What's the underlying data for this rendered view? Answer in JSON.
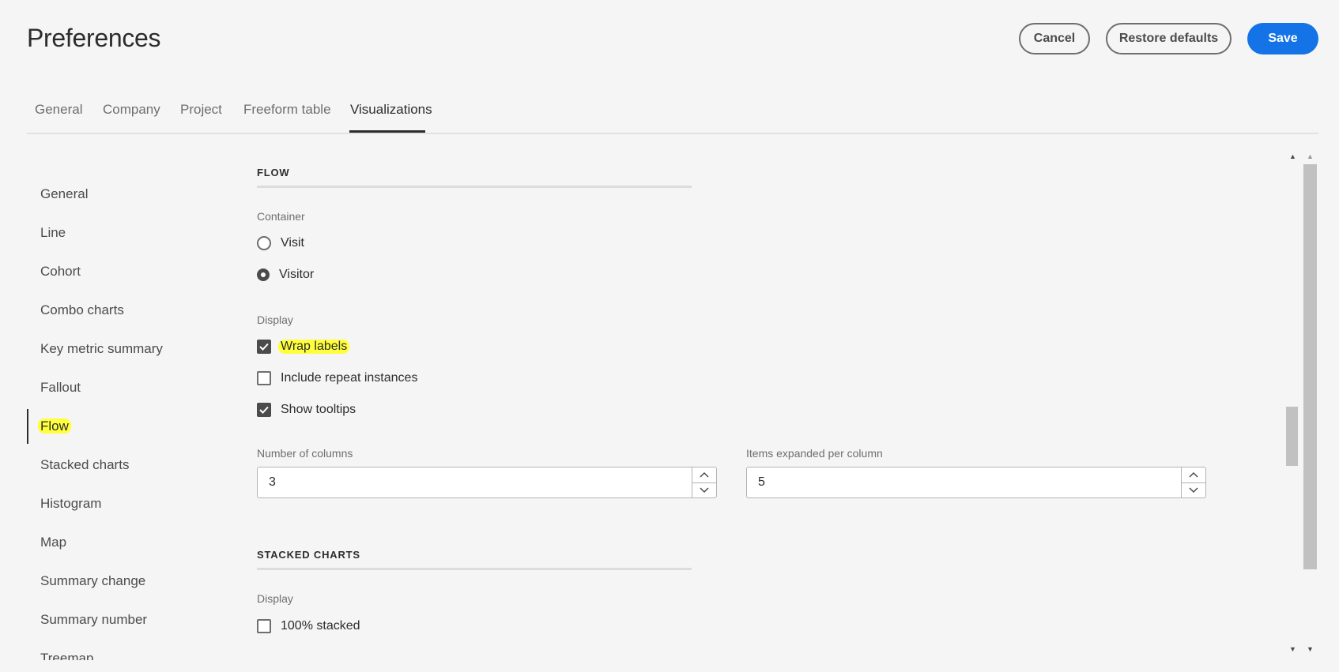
{
  "header": {
    "title": "Preferences",
    "cancel_label": "Cancel",
    "restore_label": "Restore defaults",
    "save_label": "Save"
  },
  "tabs": [
    {
      "label": "General"
    },
    {
      "label": "Company"
    },
    {
      "label": "Project"
    },
    {
      "label": "Freeform table"
    },
    {
      "label": "Visualizations",
      "active": true
    }
  ],
  "sidebar": {
    "items": [
      {
        "label": "General"
      },
      {
        "label": "Line"
      },
      {
        "label": "Cohort"
      },
      {
        "label": "Combo charts"
      },
      {
        "label": "Key metric summary"
      },
      {
        "label": "Fallout"
      },
      {
        "label": "Flow",
        "selected": true
      },
      {
        "label": "Stacked charts"
      },
      {
        "label": "Histogram"
      },
      {
        "label": "Map"
      },
      {
        "label": "Summary change"
      },
      {
        "label": "Summary number"
      },
      {
        "label": "Treemap"
      }
    ]
  },
  "flow": {
    "section_title": "FLOW",
    "container_label": "Container",
    "container_options": [
      {
        "label": "Visit",
        "selected": false
      },
      {
        "label": "Visitor",
        "selected": true
      }
    ],
    "display_label": "Display",
    "display_options": [
      {
        "label": "Wrap labels",
        "checked": true
      },
      {
        "label": "Include repeat instances",
        "checked": false
      },
      {
        "label": "Show tooltips",
        "checked": true
      }
    ],
    "columns_label": "Number of columns",
    "columns_value": "3",
    "items_label": "Items expanded per column",
    "items_value": "5"
  },
  "stacked": {
    "section_title": "STACKED CHARTS",
    "display_label": "Display",
    "options": [
      {
        "label": "100% stacked",
        "checked": false
      }
    ]
  },
  "colors": {
    "accent": "#1473e6",
    "highlight": "#ffff3b",
    "background": "#f5f5f5"
  }
}
